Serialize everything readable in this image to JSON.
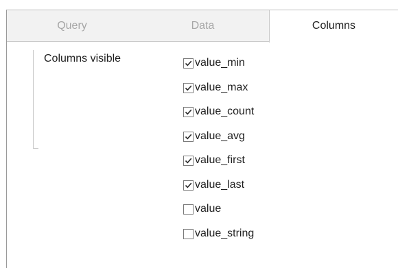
{
  "tabs": [
    {
      "label": "Query",
      "active": false
    },
    {
      "label": "Data",
      "active": false
    },
    {
      "label": "Columns",
      "active": true
    }
  ],
  "columns_panel": {
    "label": "Columns visible",
    "columns": [
      {
        "name": "value_min",
        "checked": true
      },
      {
        "name": "value_max",
        "checked": true
      },
      {
        "name": "value_count",
        "checked": true
      },
      {
        "name": "value_avg",
        "checked": true
      },
      {
        "name": "value_first",
        "checked": true
      },
      {
        "name": "value_last",
        "checked": true
      },
      {
        "name": "value",
        "checked": false
      },
      {
        "name": "value_string",
        "checked": false
      }
    ]
  }
}
